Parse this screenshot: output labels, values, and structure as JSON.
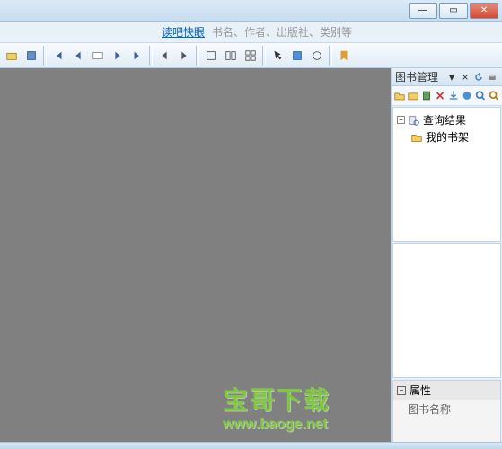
{
  "titlebar": {
    "min": "—",
    "max": "▭",
    "close": "✕"
  },
  "menubar": {
    "link": "读吧快眼",
    "searchhint": "书名、作者、出版社、类别等"
  },
  "sidebar": {
    "panel_title": "图书管理",
    "tree": {
      "item1": "查询结果",
      "item2": "我的书架"
    },
    "properties": {
      "title": "属性",
      "name_label": "图书名称"
    }
  },
  "watermark": {
    "text": "宝哥下载",
    "url": "www.baoge.net"
  }
}
